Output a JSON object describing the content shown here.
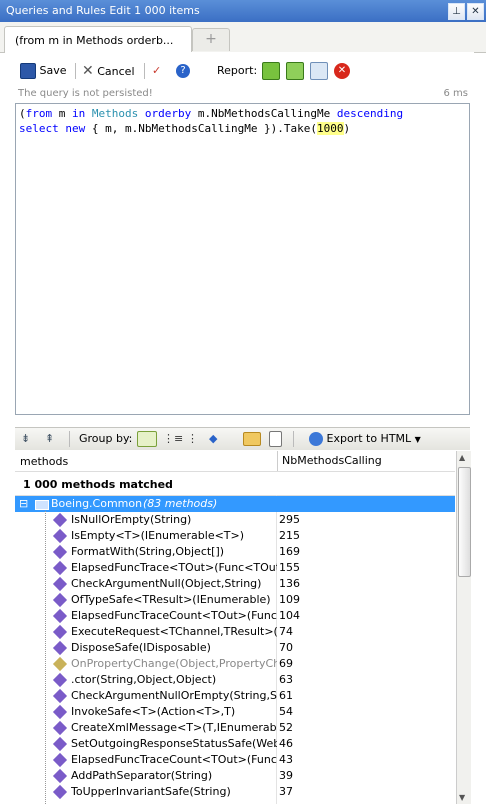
{
  "window": {
    "title": "Queries and Rules Edit  1 000 items",
    "pin_icon": "pin-icon",
    "close_icon": "close-icon"
  },
  "tabs": [
    {
      "label": "(from m in Methods orderb..."
    },
    {
      "label": "+"
    }
  ],
  "toolbar": {
    "save_label": "Save",
    "cancel_label": "Cancel",
    "report_label": "Report:"
  },
  "status": {
    "message": "The query is not persisted!",
    "elapsed": "6 ms"
  },
  "editor": {
    "line1": {
      "open": "(",
      "from": "from",
      "sp1": " m ",
      "in": "in",
      "sp2": " ",
      "methods": "Methods",
      "sp3": " ",
      "orderby": "orderby",
      "expr": " m.NbMethodsCallingMe ",
      "descending": "descending"
    },
    "line2": {
      "select": "select",
      "sp1": " ",
      "new": "new",
      "rest": " { m, m.NbMethodsCallingMe }).Take(",
      "num": "1000",
      "close": ")"
    }
  },
  "group_bar": {
    "group_by_label": "Group by:",
    "export_label": "Export to HTML"
  },
  "grid": {
    "col_methods": "methods",
    "col_metric": "NbMethodsCallingMe",
    "summary": "1 000 methods matched",
    "group_name": "Boeing.Common",
    "group_count": "(83 methods)",
    "rows": [
      {
        "name": "IsNullOrEmpty(String)",
        "value": "295"
      },
      {
        "name": "IsEmpty<T>(IEnumerable<T>)",
        "value": "215"
      },
      {
        "name": "FormatWith(String,Object[])",
        "value": "169"
      },
      {
        "name": "ElapsedFuncTrace<TOut>(Func<TOut>,S",
        "value": "155"
      },
      {
        "name": "CheckArgumentNull(Object,String)",
        "value": "136"
      },
      {
        "name": "OfTypeSafe<TResult>(IEnumerable)",
        "value": "109"
      },
      {
        "name": "ElapsedFuncTraceCount<TOut>(Func<T",
        "value": "104"
      },
      {
        "name": "ExecuteRequest<TChannel,TResult>(Cha",
        "value": "74"
      },
      {
        "name": "DisposeSafe(IDisposable)",
        "value": "70"
      },
      {
        "name": "OnPropertyChange(Object,PropertyChang",
        "value": "69"
      },
      {
        "name": ".ctor(String,Object,Object)",
        "value": "63"
      },
      {
        "name": "CheckArgumentNullOrEmpty(String,String",
        "value": "61"
      },
      {
        "name": "InvokeSafe<T>(Action<T>,T)",
        "value": "54"
      },
      {
        "name": "CreateXmlMessage<T>(T,IEnumerable<K",
        "value": "52"
      },
      {
        "name": "SetOutgoingResponseStatusSafe(WebOp",
        "value": "46"
      },
      {
        "name": "ElapsedFuncTraceCount<TOut>(Func<TC",
        "value": "43"
      },
      {
        "name": "AddPathSeparator(String)",
        "value": "39"
      },
      {
        "name": "ToUpperInvariantSafe(String)",
        "value": "37"
      }
    ]
  },
  "colors": {
    "selection": "#3399ff",
    "keyword": "#0000ff",
    "type": "#2b91af",
    "highlight": "#ffff8a",
    "title_bar": "#3b6fc4"
  }
}
